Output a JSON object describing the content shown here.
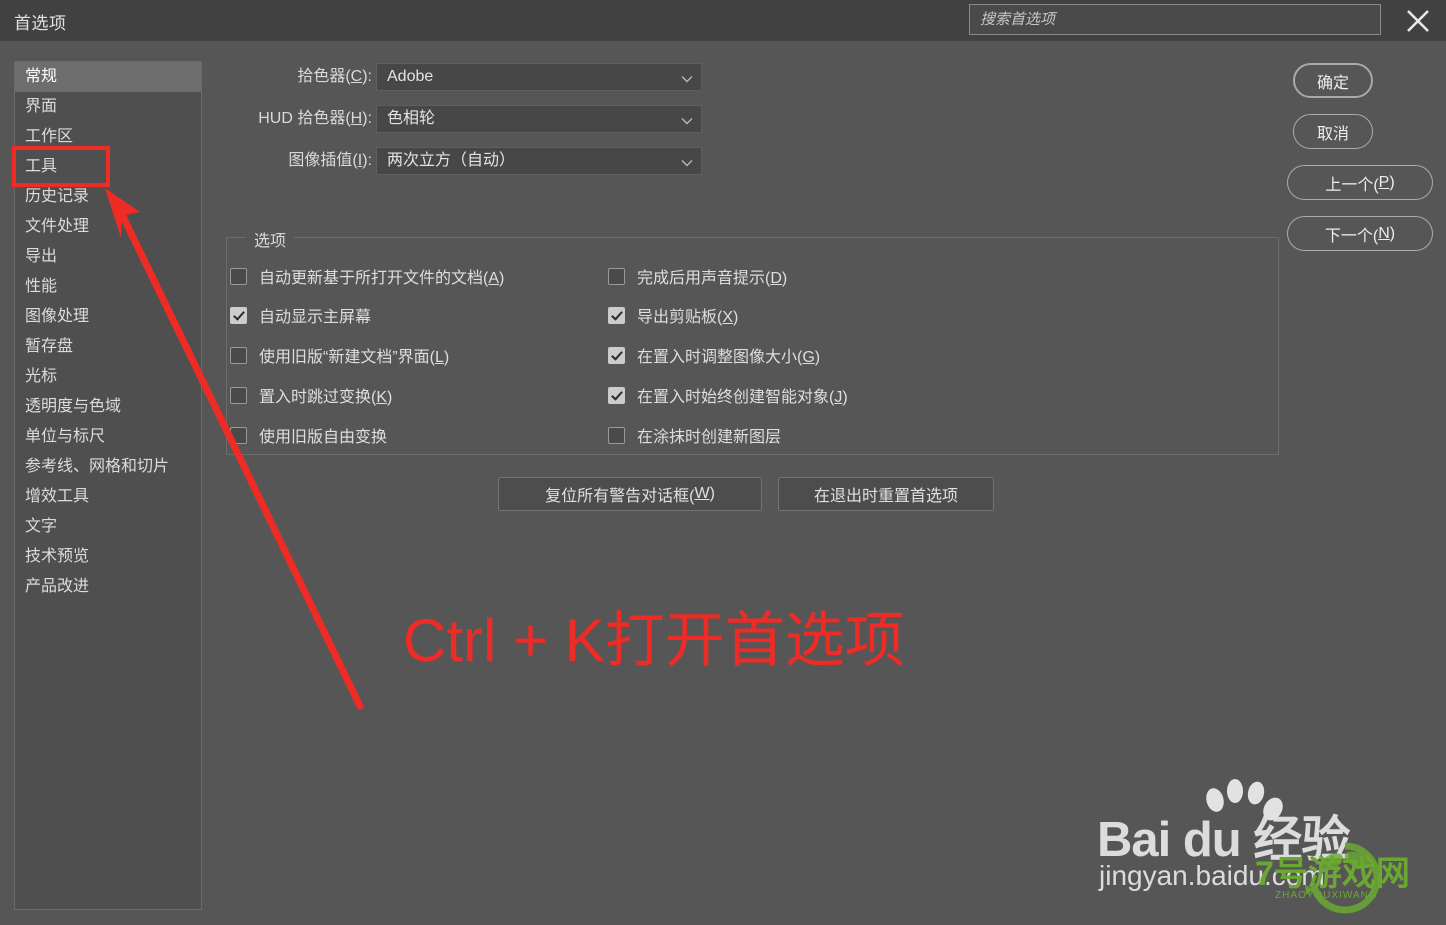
{
  "window": {
    "title": "首选项",
    "close_icon": "close-icon"
  },
  "search": {
    "placeholder": "搜索首选项",
    "value": ""
  },
  "sidebar": {
    "items": [
      {
        "label": "常规",
        "selected": true
      },
      {
        "label": "界面",
        "selected": false
      },
      {
        "label": "工作区",
        "selected": false
      },
      {
        "label": "工具",
        "selected": false
      },
      {
        "label": "历史记录",
        "selected": false
      },
      {
        "label": "文件处理",
        "selected": false
      },
      {
        "label": "导出",
        "selected": false
      },
      {
        "label": "性能",
        "selected": false
      },
      {
        "label": "图像处理",
        "selected": false
      },
      {
        "label": "暂存盘",
        "selected": false
      },
      {
        "label": "光标",
        "selected": false
      },
      {
        "label": "透明度与色域",
        "selected": false
      },
      {
        "label": "单位与标尺",
        "selected": false
      },
      {
        "label": "参考线、网格和切片",
        "selected": false
      },
      {
        "label": "增效工具",
        "selected": false
      },
      {
        "label": "文字",
        "selected": false
      },
      {
        "label": "技术预览",
        "selected": false
      },
      {
        "label": "产品改进",
        "selected": false
      }
    ]
  },
  "fields": [
    {
      "label_pre": "拾色器(",
      "label_key": "C",
      "label_post": "):",
      "value": "Adobe"
    },
    {
      "label_pre": "HUD 拾色器(",
      "label_key": "H",
      "label_post": "):",
      "value": "色相轮"
    },
    {
      "label_pre": "图像插值(",
      "label_key": "I",
      "label_post": "):",
      "value": "两次立方（自动）"
    }
  ],
  "options_group": {
    "legend": "选项",
    "left_column": [
      {
        "label_pre": "自动更新基于所打开文件的文档(",
        "label_key": "A",
        "label_post": ")",
        "checked": false
      },
      {
        "label_pre": "自动显示主屏幕",
        "label_key": "",
        "label_post": "",
        "checked": true
      },
      {
        "label_pre": "使用旧版“新建文档”界面(",
        "label_key": "L",
        "label_post": ")",
        "checked": false
      },
      {
        "label_pre": "置入时跳过变换(",
        "label_key": "K",
        "label_post": ")",
        "checked": false
      },
      {
        "label_pre": "使用旧版自由变换",
        "label_key": "",
        "label_post": "",
        "checked": false
      }
    ],
    "right_column": [
      {
        "label_pre": "完成后用声音提示(",
        "label_key": "D",
        "label_post": ")",
        "checked": false
      },
      {
        "label_pre": "导出剪贴板(",
        "label_key": "X",
        "label_post": ")",
        "checked": true
      },
      {
        "label_pre": "在置入时调整图像大小(",
        "label_key": "G",
        "label_post": ")",
        "checked": true
      },
      {
        "label_pre": "在置入时始终创建智能对象(",
        "label_key": "J",
        "label_post": ")",
        "checked": true
      },
      {
        "label_pre": "在涂抹时创建新图层",
        "label_key": "",
        "label_post": "",
        "checked": false
      }
    ]
  },
  "action_buttons": [
    {
      "label_pre": "复位所有警告对话框(",
      "label_key": "W",
      "label_post": ")"
    },
    {
      "label_pre": "在退出时重置首选项",
      "label_key": "",
      "label_post": ""
    }
  ],
  "side_buttons": [
    {
      "label_pre": "确定",
      "label_key": "",
      "label_post": "",
      "primary": true
    },
    {
      "label_pre": "取消",
      "label_key": "",
      "label_post": "",
      "primary": false
    },
    {
      "label_pre": "上一个(",
      "label_key": "P",
      "label_post": ")",
      "primary": false
    },
    {
      "label_pre": "下一个(",
      "label_key": "N",
      "label_post": ")",
      "primary": false
    }
  ],
  "annotation": {
    "text": "Ctrl + K打开首选项",
    "color": "#ef2b26",
    "highlight_box_target": "工具",
    "arrow": "red-arrow"
  },
  "watermark": {
    "brand": "Bai du 经验",
    "brand_main": "Baidu",
    "brand_suffix": "经验",
    "url": "jingyan.baidu.com",
    "logo_text": "7号游戏网",
    "logo_subtext": "ZHAOYOUXIWANG",
    "logo_color": "#6aa832"
  }
}
